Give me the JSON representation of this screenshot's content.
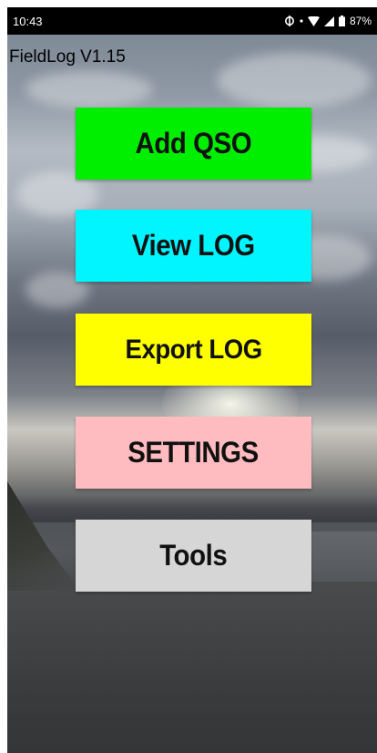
{
  "status_bar": {
    "time": "10:43",
    "battery": "87%"
  },
  "app": {
    "title": "FieldLog V1.15"
  },
  "menu": {
    "buttons": [
      {
        "label": "Add QSO",
        "color": "#00ee00"
      },
      {
        "label": "View LOG",
        "color": "#00f5ff"
      },
      {
        "label": "Export LOG",
        "color": "#ffff00"
      },
      {
        "label": "SETTINGS",
        "color": "#ffbcc0"
      },
      {
        "label": "Tools",
        "color": "#d6d6d6"
      }
    ]
  },
  "icons": {
    "status": [
      "sync-icon",
      "dot-icon",
      "wifi-icon",
      "signal-icon",
      "battery-icon"
    ]
  }
}
